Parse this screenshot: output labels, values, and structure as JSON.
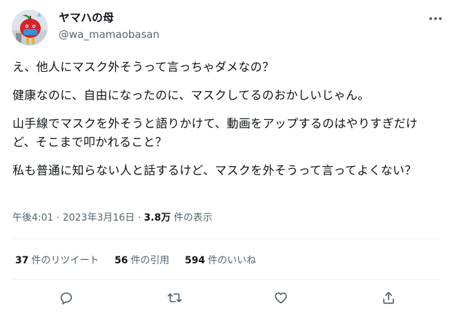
{
  "user": {
    "display_name": "ヤマハの母",
    "handle": "@wa_mamaobasan"
  },
  "tweet": {
    "paragraphs": [
      "え、他人にマスク外そうって言っちゃダメなの？",
      "健康なのに、自由になったのに、マスクしてるのおかしいじゃん。",
      "山手線でマスクを外そうと語りかけて、動画をアップするのはやりすぎだけど、そこまで叩かれること？",
      "私も普通に知らない人と話するけど、マスクを外そうって言ってよくない？"
    ]
  },
  "meta": {
    "time": "午後4:01",
    "separator": "·",
    "date": "2023年3月16日",
    "views_count": "3.8万",
    "views_label": "件の表示"
  },
  "stats": {
    "retweets": {
      "count": "37",
      "label": "件のリツイート"
    },
    "quotes": {
      "count": "56",
      "label": "件の引用"
    },
    "likes": {
      "count": "594",
      "label": "件のいいね"
    }
  },
  "icons": {
    "more": "more-horizontal-icon",
    "reply": "reply-icon",
    "retweet": "retweet-icon",
    "like": "heart-icon",
    "share": "share-icon"
  },
  "colors": {
    "text": "#0f1419",
    "secondary": "#536471",
    "divider": "#eff3f4"
  }
}
